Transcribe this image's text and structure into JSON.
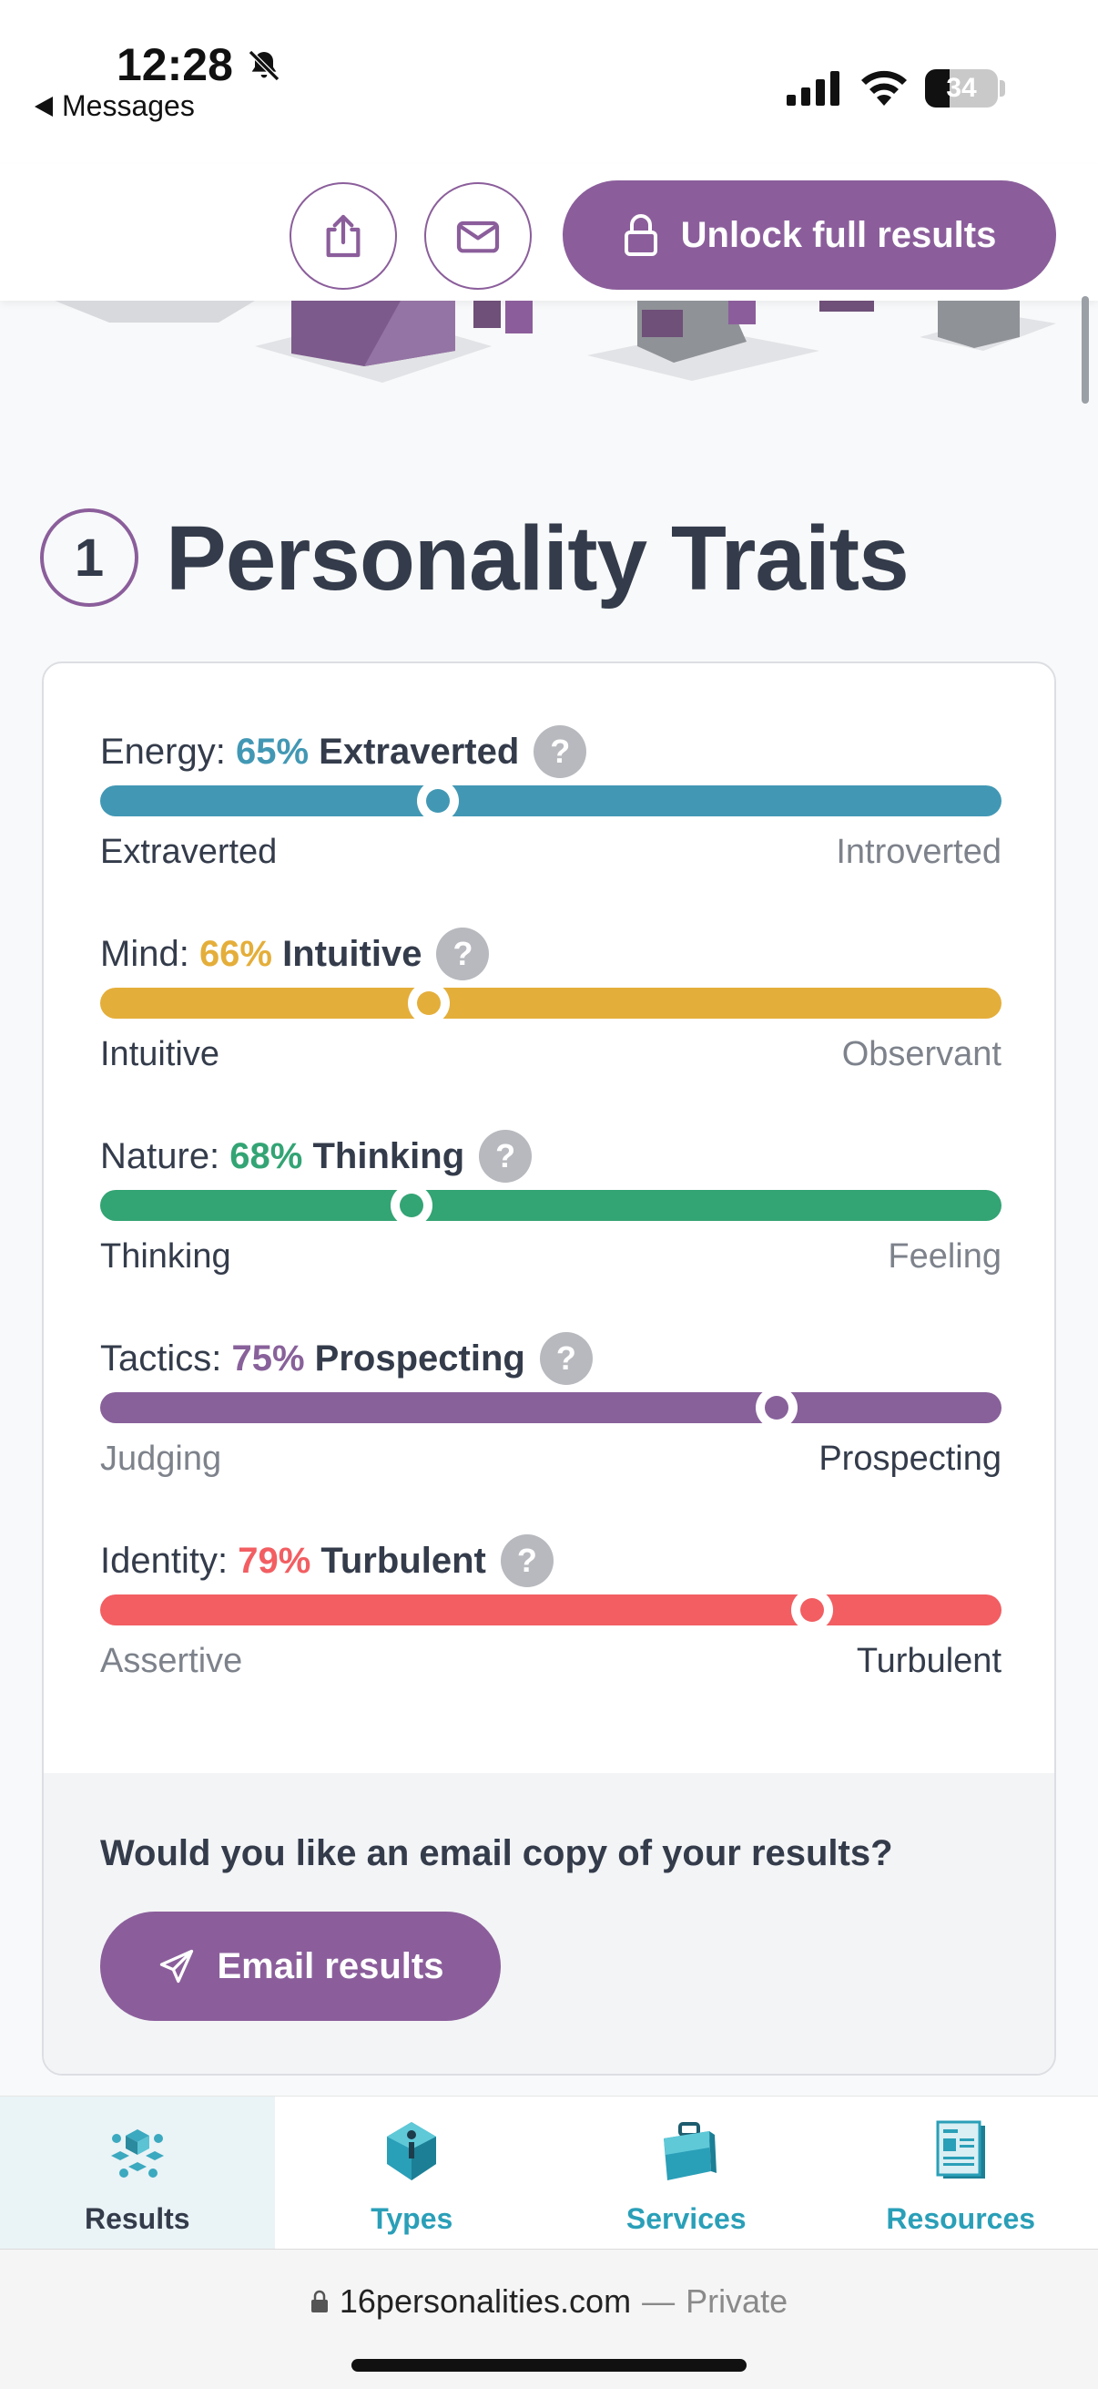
{
  "status_bar": {
    "time": "12:28",
    "back_label": "Messages",
    "battery": "34"
  },
  "header": {
    "unlock_label": "Unlock full results"
  },
  "section": {
    "number": "1",
    "title": "Personality Traits"
  },
  "traits": [
    {
      "name": "Energy:",
      "percent": "65%",
      "result": "Extraverted",
      "left": "Extraverted",
      "right": "Introverted",
      "level": 0.375,
      "color": "#4298b4",
      "active_side": "left"
    },
    {
      "name": "Mind:",
      "percent": "66%",
      "result": "Intuitive",
      "left": "Intuitive",
      "right": "Observant",
      "level": 0.365,
      "color": "#e4ae3a",
      "active_side": "left"
    },
    {
      "name": "Nature:",
      "percent": "68%",
      "result": "Thinking",
      "left": "Thinking",
      "right": "Feeling",
      "level": 0.345,
      "color": "#33a474",
      "active_side": "left"
    },
    {
      "name": "Tactics:",
      "percent": "75%",
      "result": "Prospecting",
      "left": "Judging",
      "right": "Prospecting",
      "level": 0.75,
      "color": "#88619a",
      "active_side": "right"
    },
    {
      "name": "Identity:",
      "percent": "79%",
      "result": "Turbulent",
      "left": "Assertive",
      "right": "Turbulent",
      "level": 0.79,
      "color": "#f25e62",
      "active_side": "right"
    }
  ],
  "help_glyph": "?",
  "email": {
    "question": "Would you like an email copy of your results?",
    "button_label": "Email results"
  },
  "nav": [
    {
      "label": "Results",
      "icon": "results-cube-icon",
      "active": true
    },
    {
      "label": "Types",
      "icon": "types-gem-icon",
      "active": false
    },
    {
      "label": "Services",
      "icon": "briefcase-icon",
      "active": false
    },
    {
      "label": "Resources",
      "icon": "document-icon",
      "active": false
    }
  ],
  "browser": {
    "domain": "16personalities.com",
    "separator": "—",
    "mode": "Private"
  },
  "colors": {
    "accent": "#8b5e9b",
    "nav_active": "#343c4b",
    "nav_inactive": "#2a9fb8"
  }
}
